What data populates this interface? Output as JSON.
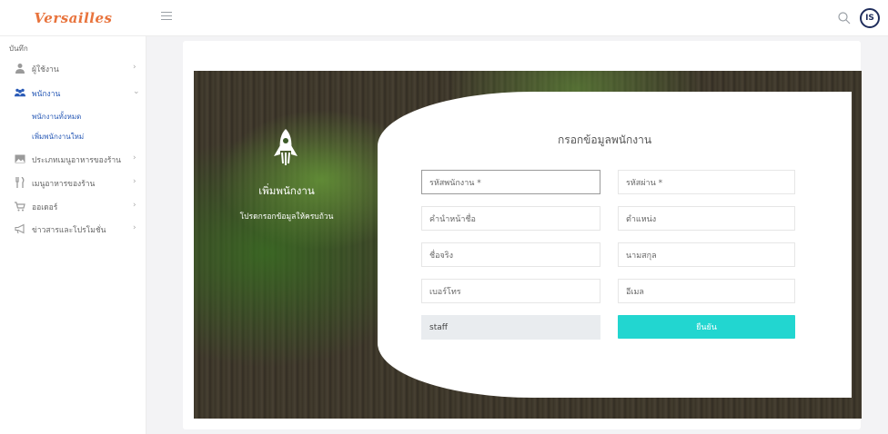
{
  "app": {
    "brand": "Versailles"
  },
  "sidebar": {
    "section_label": "บันทึก",
    "items": [
      {
        "label": "ผู้ใช้งาน",
        "icon": "user-icon"
      },
      {
        "label": "พนักงาน",
        "icon": "users-icon"
      },
      {
        "label": "ประเภทเมนูอาหารของร้าน",
        "icon": "image-icon"
      },
      {
        "label": "เมนูอาหารของร้าน",
        "icon": "utensils-icon"
      },
      {
        "label": "ออเดอร์",
        "icon": "cart-icon"
      },
      {
        "label": "ข่าวสารและโปรโมชั่น",
        "icon": "megaphone-icon"
      }
    ],
    "subitems": [
      {
        "label": "พนักงานทั้งหมด"
      },
      {
        "label": "เพิ่มพนักงานใหม่"
      }
    ]
  },
  "header": {
    "avatar_text": "IS"
  },
  "hero": {
    "title": "เพิ่มพนักงาน",
    "subtitle": "โปรดกรอกข้อมูลให้ครบถ้วน"
  },
  "form": {
    "title": "กรอกข้อมูลพนักงาน",
    "employee_id_placeholder": "รหัสพนักงาน *",
    "password_placeholder": "รหัสผ่าน *",
    "prefix_placeholder": "คำนำหน้าชื่อ",
    "position_placeholder": "ตำแหน่ง",
    "firstname_placeholder": "ชื่อจริง",
    "lastname_placeholder": "นามสกุล",
    "phone_placeholder": "เบอร์โทร",
    "email_placeholder": "อีเมล",
    "role_value": "staff",
    "submit_label": "ยืนยัน"
  },
  "colors": {
    "brand": "#e8733c",
    "accent": "#22d6d0",
    "link": "#2a5bb7"
  }
}
